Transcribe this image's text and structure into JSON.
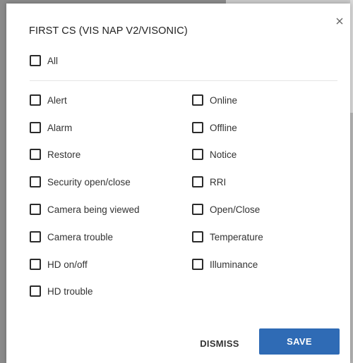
{
  "dialog": {
    "title": "FIRST CS (VIS NAP V2/VISONIC)",
    "close_icon": "close-icon",
    "all_label": "All",
    "left_options": [
      {
        "label": "Alert",
        "checked": false
      },
      {
        "label": "Alarm",
        "checked": false
      },
      {
        "label": "Restore",
        "checked": false
      },
      {
        "label": "Security open/close",
        "checked": false
      },
      {
        "label": "Camera being viewed",
        "checked": false
      },
      {
        "label": "Camera trouble",
        "checked": false
      },
      {
        "label": "HD on/off",
        "checked": false
      },
      {
        "label": "HD trouble",
        "checked": false
      }
    ],
    "right_options": [
      {
        "label": "Online",
        "checked": false
      },
      {
        "label": "Offline",
        "checked": false
      },
      {
        "label": "Notice",
        "checked": false
      },
      {
        "label": "RRI",
        "checked": false
      },
      {
        "label": "Open/Close",
        "checked": false
      },
      {
        "label": "Temperature",
        "checked": false
      },
      {
        "label": "Illuminance",
        "checked": false
      }
    ],
    "dismiss_label": "DISMISS",
    "save_label": "SAVE",
    "colors": {
      "primary": "#2f6bb5",
      "text": "#333333"
    }
  }
}
